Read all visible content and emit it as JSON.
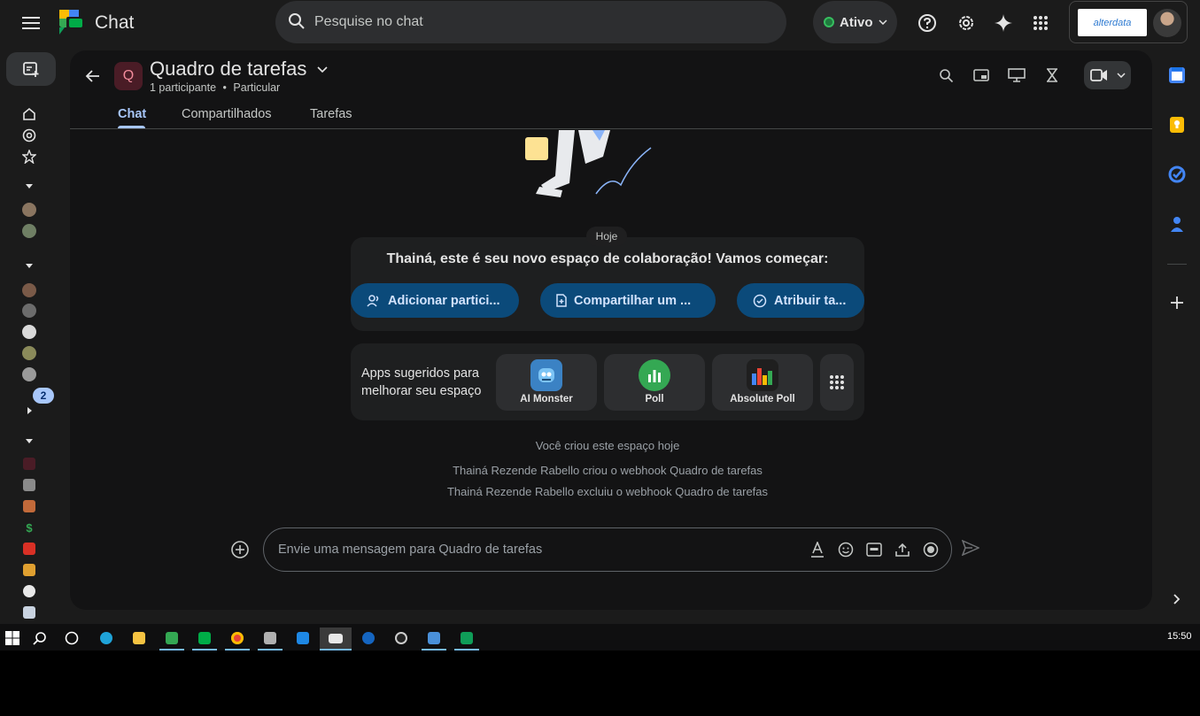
{
  "topbar": {
    "app_title": "Chat",
    "search_placeholder": "Pesquise no chat",
    "status_label": "Ativo",
    "account_brand": "alterdata"
  },
  "rail": {
    "unread_badge": "2"
  },
  "space": {
    "avatar_letter": "Q",
    "title": "Quadro de tarefas",
    "participants": "1 participante",
    "separator": "•",
    "visibility": "Particular"
  },
  "tabs": [
    {
      "label": "Chat",
      "active": true
    },
    {
      "label": "Compartilhados",
      "active": false
    },
    {
      "label": "Tarefas",
      "active": false
    }
  ],
  "conversation": {
    "date_chip": "Hoje",
    "welcome": "Thainá, este é seu novo espaço de colaboração! Vamos começar:",
    "actions": [
      {
        "label": "Adicionar partici...",
        "icon": "add-people-icon"
      },
      {
        "label": "Compartilhar um ...",
        "icon": "file-add-icon"
      },
      {
        "label": "Atribuir ta...",
        "icon": "task-add-icon"
      }
    ],
    "apps_label": "Apps sugeridos para melhorar seu espaço",
    "apps": [
      {
        "name": "AI Monster",
        "icon": "monster-icon",
        "color": "#3b82c4"
      },
      {
        "name": "Poll",
        "icon": "poll-icon",
        "color": "#34a853"
      },
      {
        "name": "Absolute Poll",
        "icon": "bar-chart-icon",
        "color": "#1f1f1f"
      }
    ],
    "system_messages": [
      "Você criou este espaço hoje",
      "Thainá Rezende Rabello criou o webhook Quadro de tarefas",
      "Thainá Rezende Rabello excluiu o webhook Quadro de tarefas"
    ]
  },
  "composer": {
    "placeholder": "Envie uma mensagem para Quadro de tarefas"
  },
  "taskbar": {
    "clock": "15:50"
  },
  "colors": {
    "accent": "#a8c7fa",
    "action_pill": "#0b4a7a",
    "status_green": "#37be5f"
  }
}
